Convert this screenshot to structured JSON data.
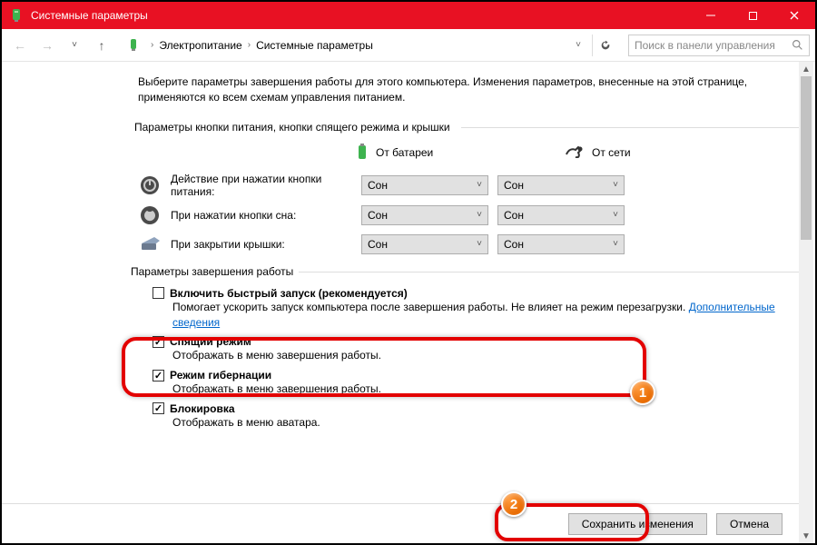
{
  "window": {
    "title": "Системные параметры",
    "breadcrumbs": [
      "Электропитание",
      "Системные параметры"
    ],
    "search_placeholder": "Поиск в панели управления"
  },
  "intro": "Выберите параметры завершения работы для этого компьютера. Изменения параметров, внесенные на этой странице, применяются ко всем схемам управления питанием.",
  "section_power_buttons": "Параметры кнопки питания, кнопки спящего режима и крышки",
  "columns": {
    "battery": "От батареи",
    "ac": "От сети"
  },
  "rows": [
    {
      "icon": "power-icon",
      "label": "Действие при нажатии кнопки питания:",
      "battery": "Сон",
      "ac": "Сон"
    },
    {
      "icon": "sleep-icon",
      "label": "При нажатии кнопки сна:",
      "battery": "Сон",
      "ac": "Сон"
    },
    {
      "icon": "lid-icon",
      "label": "При закрытии крышки:",
      "battery": "Сон",
      "ac": "Сон"
    }
  ],
  "section_shutdown": "Параметры завершения работы",
  "shutdown_opts": [
    {
      "checked": false,
      "title": "Включить быстрый запуск (рекомендуется)",
      "desc_prefix": "Помогает ускорить запуск компьютера после завершения работы. Не влияет на режим перезагрузки. ",
      "link": "Дополнительные сведения"
    },
    {
      "checked": true,
      "title": "Спящий режим",
      "desc_prefix": "Отображать в меню завершения работы.",
      "link": ""
    },
    {
      "checked": true,
      "title": "Режим гибернации",
      "desc_prefix": "Отображать в меню завершения работы.",
      "link": ""
    },
    {
      "checked": true,
      "title": "Блокировка",
      "desc_prefix": "Отображать в меню аватара.",
      "link": ""
    }
  ],
  "buttons": {
    "save": "Сохранить изменения",
    "cancel": "Отмена"
  },
  "badges": {
    "one": "1",
    "two": "2"
  }
}
